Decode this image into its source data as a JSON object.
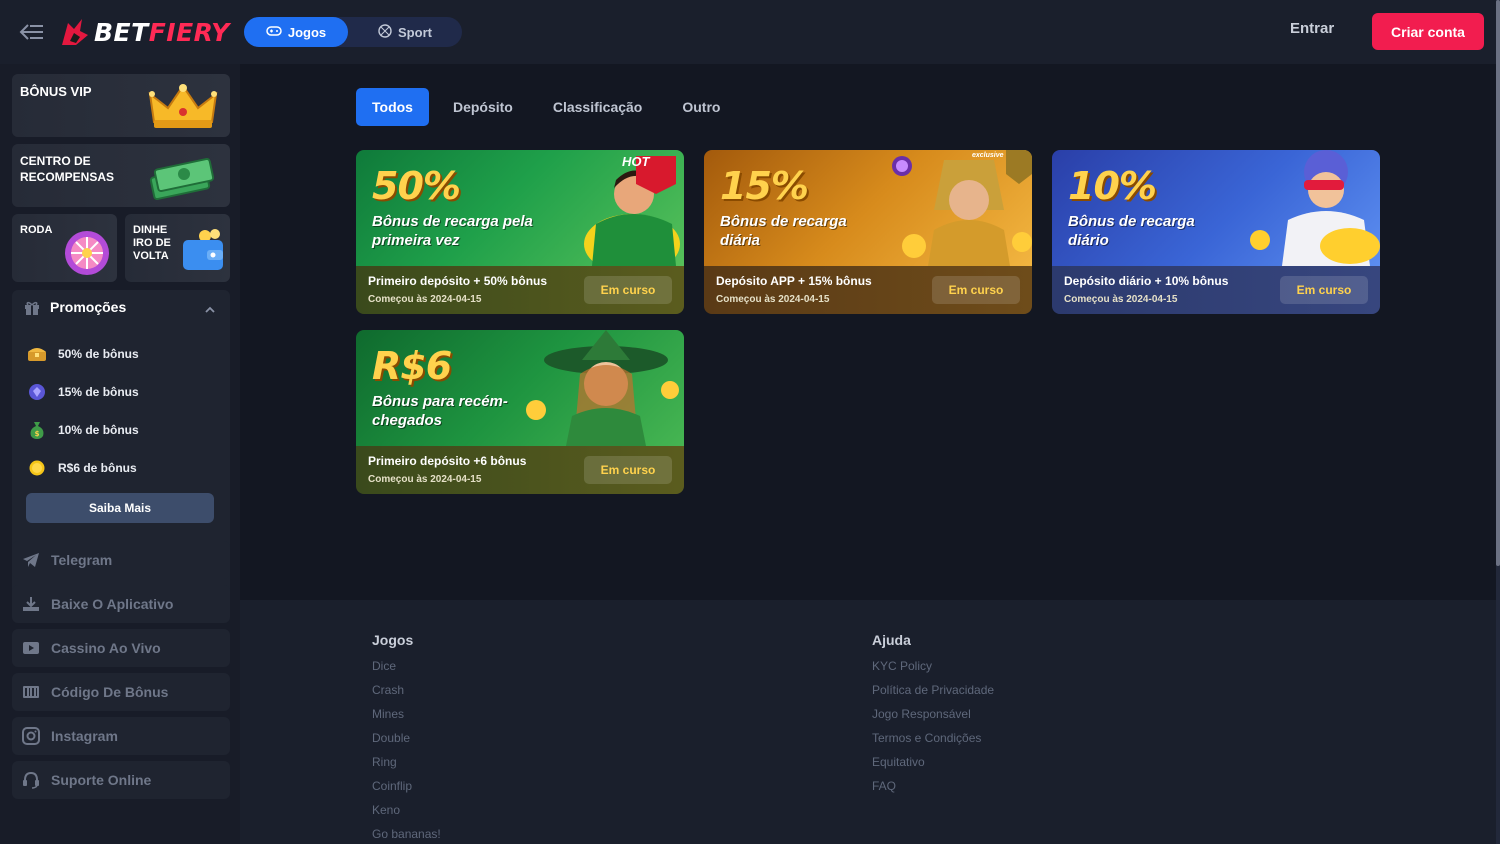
{
  "header": {
    "logo_bet": "BET",
    "logo_fiery": "FIERY",
    "nav": [
      {
        "label": "Jogos",
        "icon": "gamepad-icon",
        "active": true
      },
      {
        "label": "Sport",
        "icon": "ball-icon",
        "active": false
      }
    ],
    "login_label": "Entrar",
    "register_label": "Criar conta"
  },
  "sidebar": {
    "vip_label": "BÔNUS VIP",
    "rewards_label": "CENTRO DE RECOMPENSAS",
    "wheel_label": "RODA",
    "cashback_label": "DINHE IRO DE VOLTA",
    "promotions": {
      "title": "Promoções",
      "items": [
        {
          "label": "50% de bônus",
          "icon": "treasure-chest-icon"
        },
        {
          "label": "15% de bônus",
          "icon": "gem-icon"
        },
        {
          "label": "10% de bônus",
          "icon": "money-bag-icon"
        },
        {
          "label": "R$6 de bônus",
          "icon": "coin-icon"
        }
      ],
      "more_label": "Saiba Mais"
    },
    "links": [
      {
        "label": "Telegram",
        "icon": "telegram-icon"
      },
      {
        "label": "Baixe O Aplicativo",
        "icon": "download-icon"
      },
      {
        "label": "Cassino Ao Vivo",
        "icon": "live-video-icon"
      },
      {
        "label": "Código De Bônus",
        "icon": "bonus-code-icon"
      },
      {
        "label": "Instagram",
        "icon": "instagram-icon"
      },
      {
        "label": "Suporte Online",
        "icon": "headset-icon"
      }
    ]
  },
  "tabs": [
    "Todos",
    "Depósito",
    "Classificação",
    "Outro"
  ],
  "promos": [
    {
      "headline": "50%",
      "subtitle": "Bônus de recarga pela primeira vez",
      "title": "Primeiro depósito + 50% bônus",
      "date": "Começou às 2024-04-15",
      "status": "Em curso",
      "badge": "HOT"
    },
    {
      "headline": "15%",
      "subtitle": "Bônus de recarga diária",
      "title": "Depósito APP + 15% bônus",
      "date": "Começou às 2024-04-15",
      "status": "Em curso",
      "badge": "exclusive"
    },
    {
      "headline": "10%",
      "subtitle": "Bônus de recarga diário",
      "title": "Depósito diário + 10% bônus",
      "date": "Começou às 2024-04-15",
      "status": "Em curso"
    },
    {
      "headline": "R$6",
      "subtitle": "Bônus para recém-chegados",
      "title": "Primeiro depósito +6 bônus",
      "date": "Começou às 2024-04-15",
      "status": "Em curso"
    }
  ],
  "footer": {
    "games": {
      "title": "Jogos",
      "links": [
        "Dice",
        "Crash",
        "Mines",
        "Double",
        "Ring",
        "Coinflip",
        "Keno",
        "Go bananas!"
      ]
    },
    "help": {
      "title": "Ajuda",
      "links": [
        "KYC Policy",
        "Política de Privacidade",
        "Jogo Responsável",
        "Termos e Condições",
        "Equitativo",
        "FAQ"
      ]
    }
  },
  "colors": {
    "accent_blue": "#1f6ff2",
    "brand_red": "#f21d4f",
    "gold": "#ffd24d"
  }
}
